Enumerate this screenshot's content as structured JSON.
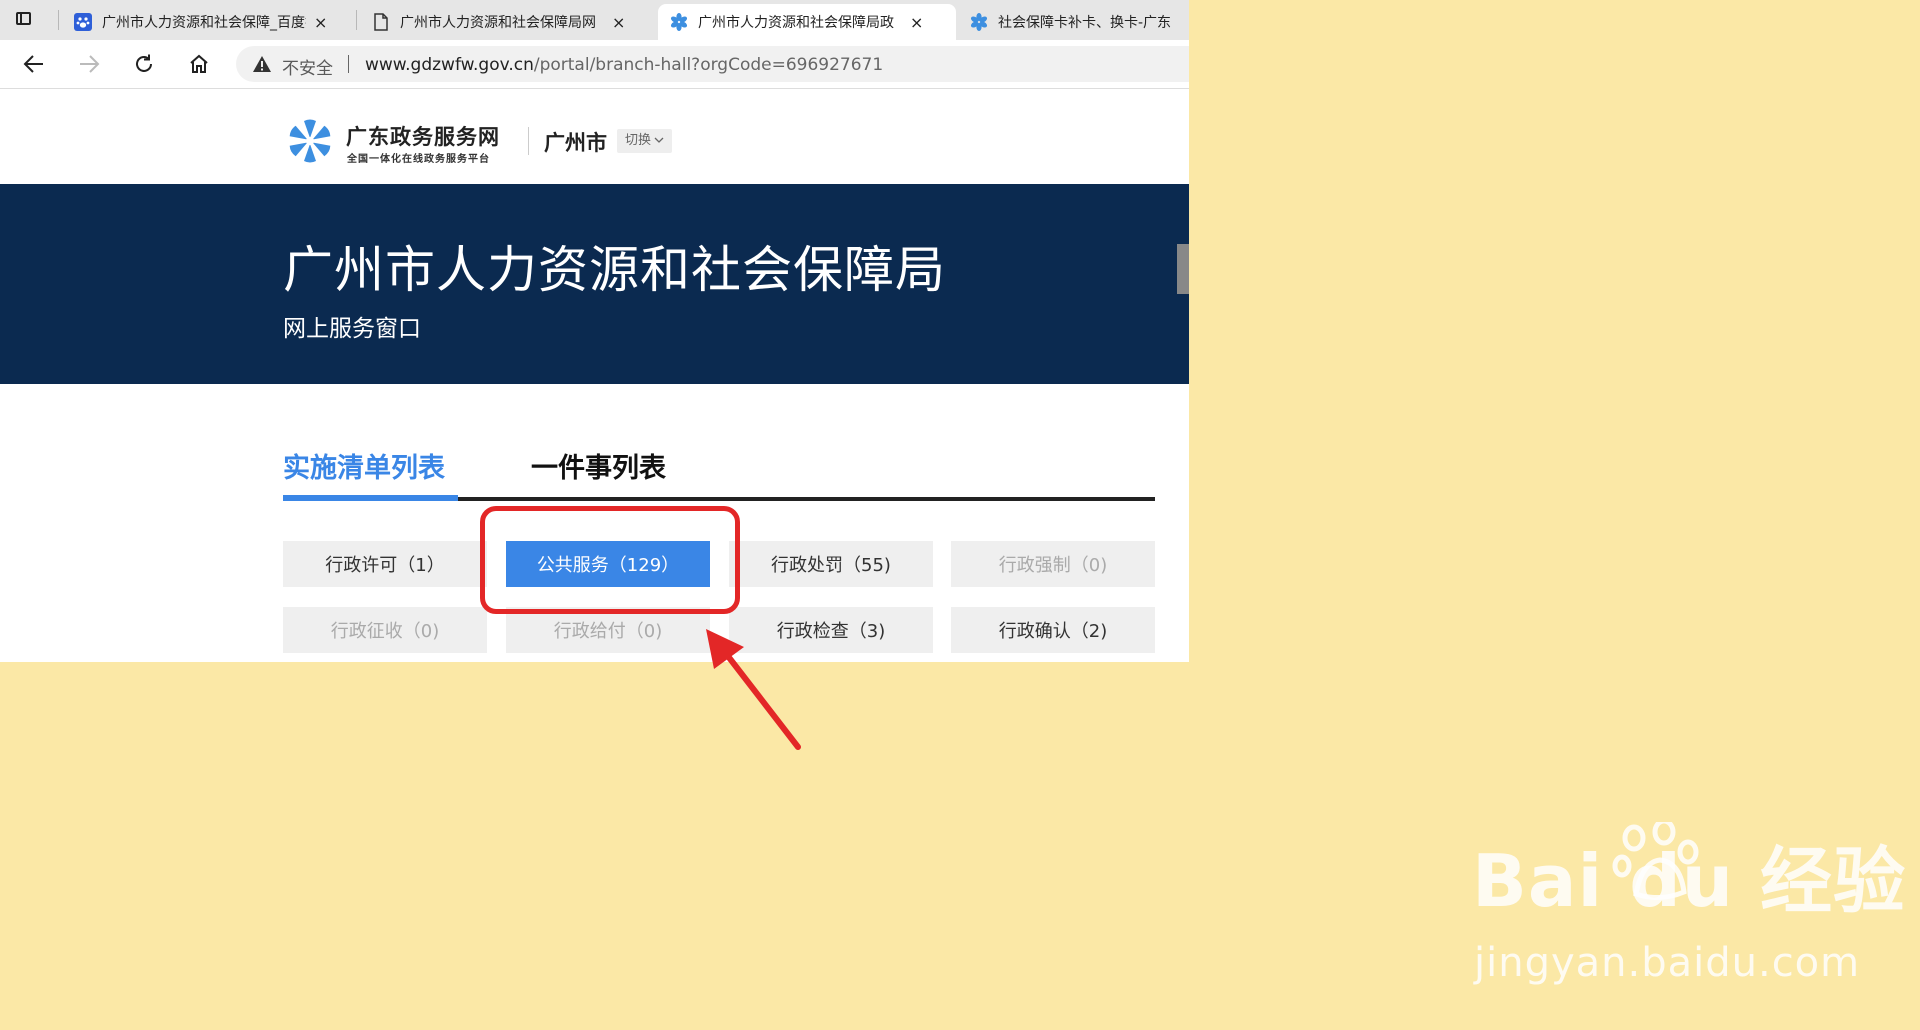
{
  "browser": {
    "tabs": [
      {
        "label": "广州市人力资源和社会保障_百度搜",
        "close": "×",
        "icon": "baidu-paw-icon"
      },
      {
        "label": "广州市人力资源和社会保障局网",
        "close": "×",
        "icon": "document-icon"
      },
      {
        "label": "广州市人力资源和社会保障局政",
        "close": "×",
        "icon": "guangdong-logo-icon"
      },
      {
        "label": "社会保障卡补卡、换卡-广东",
        "close": "×",
        "icon": "guangdong-logo-icon"
      }
    ],
    "security_label": "不安全",
    "url_host": "www.gdzwfw.gov.cn",
    "url_path": "/portal/branch-hall?orgCode=696927671"
  },
  "header": {
    "logo_title": "广东政务服务网",
    "logo_subtitle": "全国一体化在线政务服务平台",
    "city": "广州市",
    "switch_label": "切换"
  },
  "banner": {
    "title": "广州市人力资源和社会保障局",
    "subtitle": "网上服务窗口"
  },
  "list_tabs": {
    "active": "实施清单列表",
    "inactive": "一件事列表"
  },
  "categories": [
    {
      "label": "行政许可（1）",
      "state": "normal"
    },
    {
      "label": "公共服务（129）",
      "state": "active"
    },
    {
      "label": "行政处罚（55)",
      "state": "normal"
    },
    {
      "label": "行政强制（0)",
      "state": "disabled"
    },
    {
      "label": "行政征收（0)",
      "state": "disabled"
    },
    {
      "label": "行政给付（0)",
      "state": "disabled"
    },
    {
      "label": "行政检查（3)",
      "state": "normal"
    },
    {
      "label": "行政确认（2)",
      "state": "normal"
    }
  ],
  "watermark": {
    "brand": "Bai du 经验",
    "url": "jingyan.baidu.com"
  },
  "colors": {
    "accent": "#3a86e6",
    "banner_bg": "#0b2a50",
    "highlight": "#e32727",
    "page_bg": "#fbe8a6"
  }
}
